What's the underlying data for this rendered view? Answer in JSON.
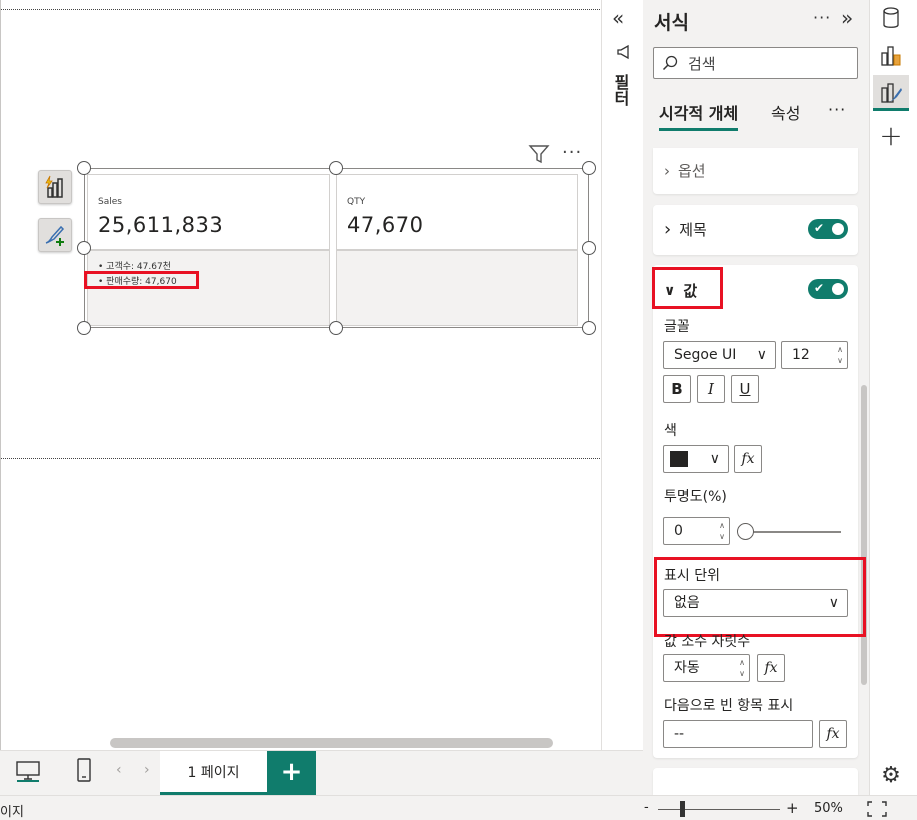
{
  "visual": {
    "card1": {
      "label": "Sales",
      "value": "25,611,833"
    },
    "card2": {
      "label": "QTY",
      "value": "47,670"
    },
    "bullets": [
      "• 고객수: 47.67천",
      "• 판매수량: 47,670"
    ]
  },
  "filter_strip": {
    "label": "필터"
  },
  "format_pane": {
    "title": "서식",
    "search_placeholder": "검색",
    "tabs": {
      "visual": "시각적 개체",
      "general": "속성"
    },
    "sections": {
      "options": "옵션",
      "title": "제목",
      "values": "값"
    },
    "values": {
      "font_label": "글꼴",
      "font_family": "Segoe UI",
      "font_size": "12",
      "bold": "B",
      "italic": "I",
      "underline": "U",
      "color_label": "색",
      "transparency_label": "투명도(%)",
      "transparency_value": "0",
      "transparency_fraction": 0,
      "display_units_label": "표시 단위",
      "display_units_value": "없음",
      "decimal_label": "값 소수 자릿수",
      "decimal_value": "자동",
      "blank_label": "다음으로 빈 항목 표시",
      "blank_value": "--",
      "fx": "fx"
    }
  },
  "page_tabs": {
    "active": "1 페이지",
    "add": "+"
  },
  "status": {
    "left": "이지",
    "zoom": "50%",
    "zoom_minus": "-",
    "zoom_plus": "+"
  },
  "colors": {
    "accent": "#107c6c",
    "highlight": "#e81123",
    "pane_bg": "#f3f2f1"
  }
}
